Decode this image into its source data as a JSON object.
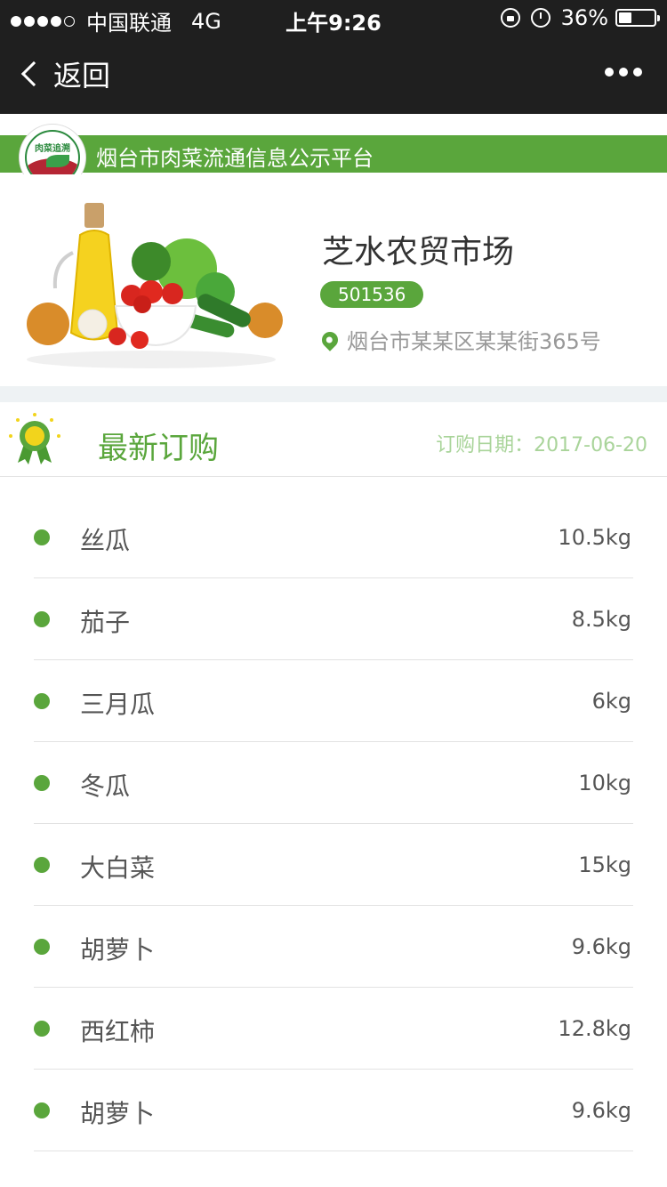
{
  "status_bar": {
    "carrier": "中国联通",
    "network": "4G",
    "time": "上午9:26",
    "battery": "36%",
    "battery_level": 0.36
  },
  "nav": {
    "back_label": "返回"
  },
  "platform": {
    "logo_text": "肉菜追溯",
    "title": "烟台市肉菜流通信息公示平台"
  },
  "market": {
    "name": "芝水农贸市场",
    "code": "501536",
    "address": "烟台市某某区某某街365号"
  },
  "orders": {
    "title": "最新订购",
    "date": "订购日期：2017-06-20",
    "items": [
      {
        "name": "丝瓜",
        "qty": "10.5kg"
      },
      {
        "name": "茄子",
        "qty": "8.5kg"
      },
      {
        "name": "三月瓜",
        "qty": "6kg"
      },
      {
        "name": "冬瓜",
        "qty": "10kg"
      },
      {
        "name": "大白菜",
        "qty": "15kg"
      },
      {
        "name": "胡萝卜",
        "qty": "9.6kg"
      },
      {
        "name": "西红柿",
        "qty": "12.8kg"
      },
      {
        "name": "胡萝卜",
        "qty": "9.6kg"
      }
    ]
  },
  "colors": {
    "accent": "#5aa63c",
    "header_bg": "#1f1f1f"
  }
}
